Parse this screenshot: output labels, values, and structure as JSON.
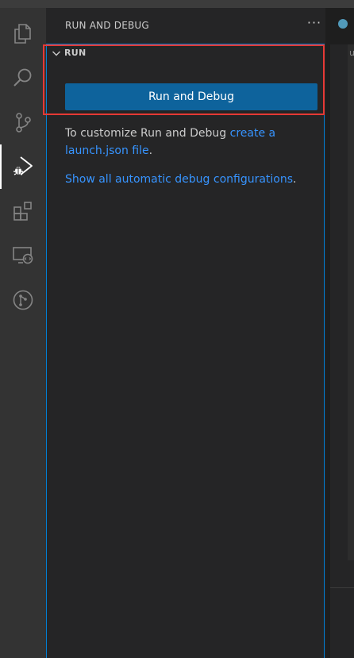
{
  "sidebar": {
    "title": "RUN AND DEBUG",
    "more_actions": "···"
  },
  "section": {
    "title": "RUN",
    "run_button_label": "Run and Debug",
    "customize_text": "To customize Run and Debug ",
    "create_link": "create a launch.json file",
    "period_1": ".",
    "auto_link": "Show all automatic debug configurations",
    "period_2": "."
  },
  "activity_bar": {
    "items": [
      {
        "icon": "explorer-icon"
      },
      {
        "icon": "search-icon"
      },
      {
        "icon": "source-control-icon"
      },
      {
        "icon": "run-and-debug-icon",
        "active": true
      },
      {
        "icon": "extensions-icon"
      },
      {
        "icon": "remote-explorer-icon"
      },
      {
        "icon": "github-icon"
      }
    ]
  },
  "editor": {
    "tab_glyph": "u"
  },
  "colors": {
    "accent": "#007fd4",
    "button": "#0e639c",
    "link": "#3794ff",
    "highlight": "#e53935"
  }
}
